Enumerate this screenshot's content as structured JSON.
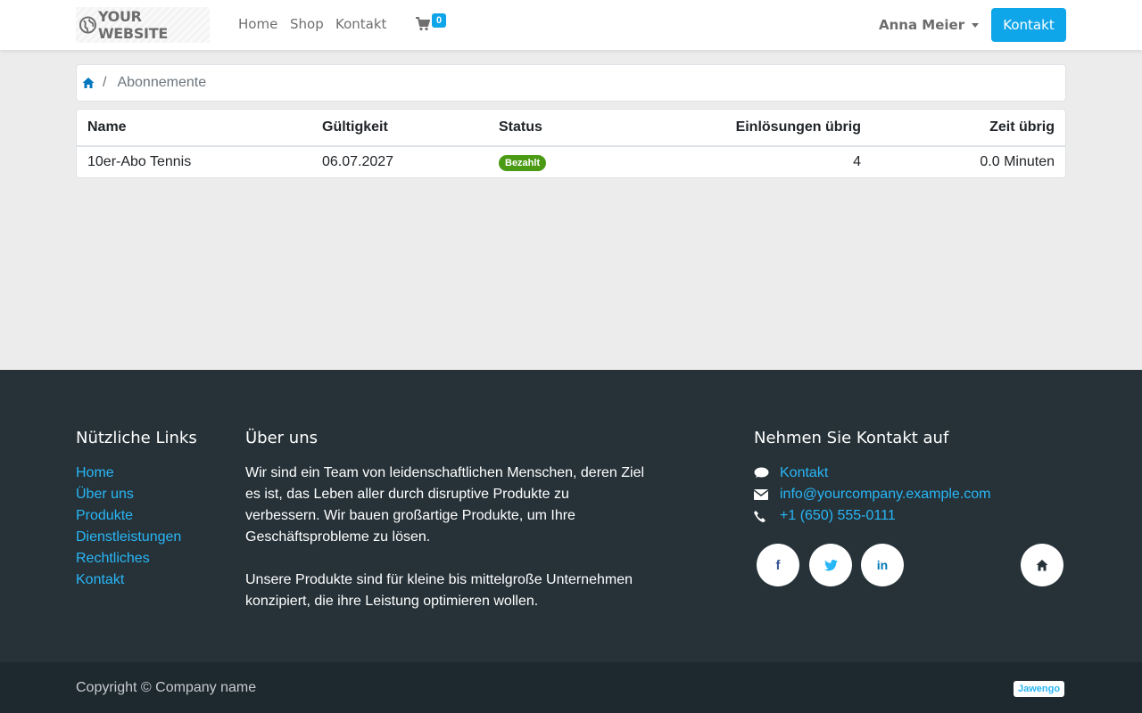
{
  "header": {
    "logo_text": "YOUR WEBSITE",
    "nav": [
      "Home",
      "Shop",
      "Kontakt"
    ],
    "cart_count": "0",
    "user_name": "Anna Meier",
    "contact_button": "Kontakt"
  },
  "breadcrumb": {
    "current": "Abonnemente",
    "separator": "/"
  },
  "table": {
    "headers": [
      "Name",
      "Gültigkeit",
      "Status",
      "Einlösungen übrig",
      "Zeit übrig"
    ],
    "rows": [
      {
        "name": "10er-Abo Tennis",
        "validity": "06.07.2027",
        "status": "Bezahlt",
        "redemptions_left": "4",
        "time_left": "0.0 Minuten"
      }
    ]
  },
  "footer": {
    "links_title": "Nützliche Links",
    "links": [
      "Home",
      "Über uns",
      "Produkte",
      "Dienstleistungen",
      "Rechtliches",
      "Kontakt"
    ],
    "about_title": "Über uns",
    "about_p1": "Wir sind ein Team von leidenschaftlichen Menschen, deren Ziel es ist, das Leben aller durch disruptive Produkte zu verbessern. Wir bauen großartige Produkte, um Ihre Geschäftsprobleme zu lösen.",
    "about_p2": "Unsere Produkte sind für kleine bis mittelgroße Unternehmen konzipiert, die ihre Leistung optimieren wollen.",
    "contact_title": "Nehmen Sie Kontakt auf",
    "contact_link": "Kontakt",
    "email": "info@yourcompany.example.com",
    "phone": "+1 (650) 555-0111",
    "social_icons": [
      "facebook-icon",
      "twitter-icon",
      "linkedin-icon",
      "home-icon"
    ],
    "copyright": "Copyright © Company name",
    "brand": "Jawengo"
  },
  "colors": {
    "accent": "#0ea5e9",
    "link": "#29b6f6",
    "footer_bg": "#263238",
    "copyright_bg": "#1e282f",
    "paid_badge": "#4a9a14"
  }
}
